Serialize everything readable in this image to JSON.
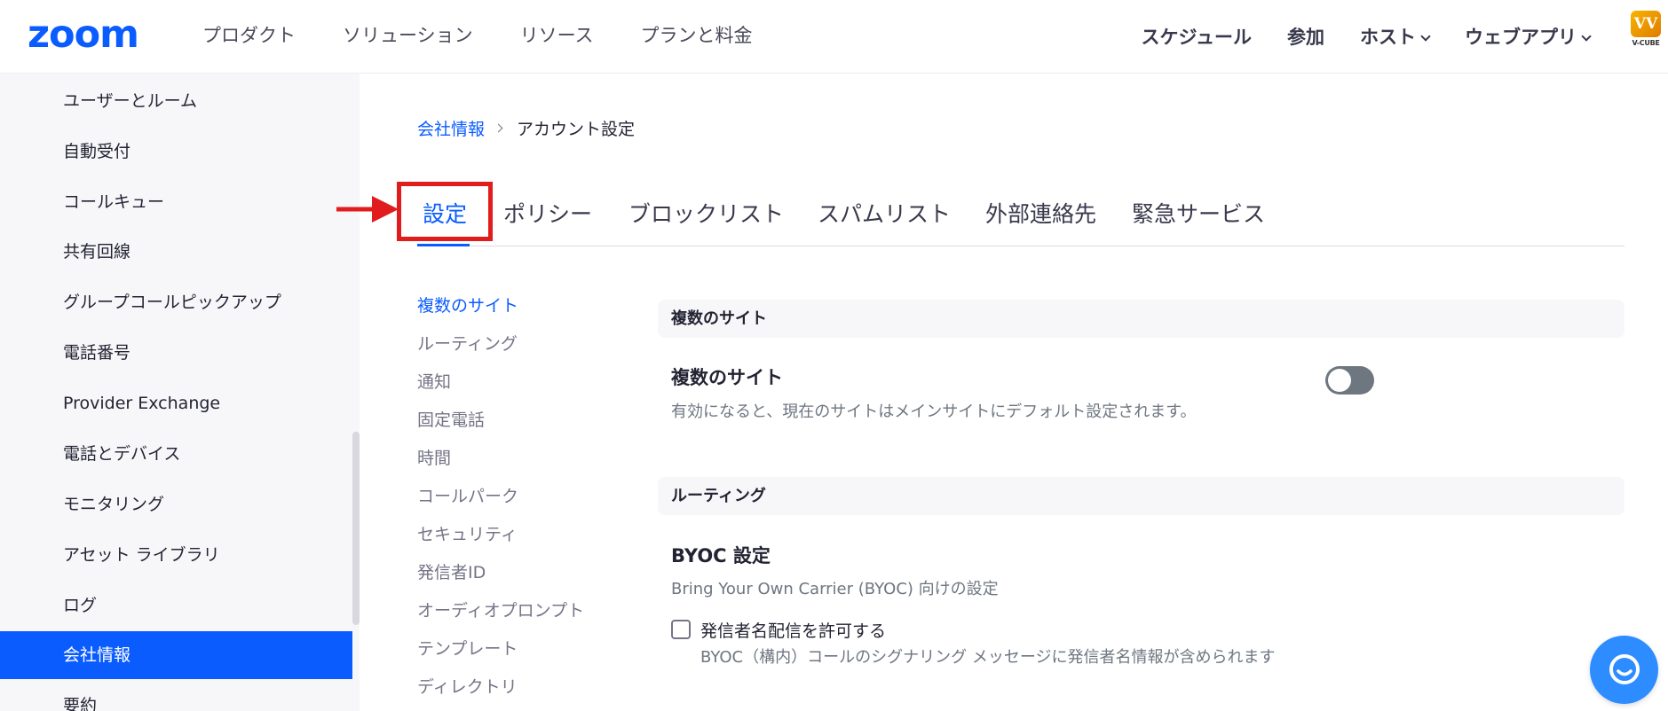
{
  "topnav": {
    "logo": "zoom",
    "left": [
      "プロダクト",
      "ソリューション",
      "リソース",
      "プランと料金"
    ],
    "right": [
      {
        "label": "スケジュール",
        "dropdown": false
      },
      {
        "label": "参加",
        "dropdown": false
      },
      {
        "label": "ホスト",
        "dropdown": true
      },
      {
        "label": "ウェブアプリ",
        "dropdown": true
      }
    ],
    "profile_logo_mark": "VV",
    "profile_logo_text": "V-CUBE"
  },
  "sidebar": {
    "items": [
      {
        "label": "ユーザーとルーム",
        "active": false
      },
      {
        "label": "自動受付",
        "active": false
      },
      {
        "label": "コールキュー",
        "active": false
      },
      {
        "label": "共有回線",
        "active": false
      },
      {
        "label": "グループコールピックアップ",
        "active": false
      },
      {
        "label": "電話番号",
        "active": false
      },
      {
        "label": "Provider Exchange",
        "active": false
      },
      {
        "label": "電話とデバイス",
        "active": false
      },
      {
        "label": "モニタリング",
        "active": false
      },
      {
        "label": "アセット ライブラリ",
        "active": false
      },
      {
        "label": "ログ",
        "active": false
      },
      {
        "label": "会社情報",
        "active": true
      },
      {
        "label": "要約",
        "active": false
      }
    ]
  },
  "breadcrumb": {
    "parent": "会社情報",
    "current": "アカウント設定"
  },
  "tabs": [
    {
      "label": "設定",
      "active": true
    },
    {
      "label": "ポリシー",
      "active": false
    },
    {
      "label": "ブロックリスト",
      "active": false
    },
    {
      "label": "スパムリスト",
      "active": false
    },
    {
      "label": "外部連絡先",
      "active": false
    },
    {
      "label": "緊急サービス",
      "active": false
    }
  ],
  "subnav": [
    {
      "label": "複数のサイト",
      "active": true
    },
    {
      "label": "ルーティング",
      "active": false
    },
    {
      "label": "通知",
      "active": false
    },
    {
      "label": "固定電話",
      "active": false
    },
    {
      "label": "時間",
      "active": false
    },
    {
      "label": "コールパーク",
      "active": false
    },
    {
      "label": "セキュリティ",
      "active": false
    },
    {
      "label": "発信者ID",
      "active": false
    },
    {
      "label": "オーディオプロンプト",
      "active": false
    },
    {
      "label": "テンプレート",
      "active": false
    },
    {
      "label": "ディレクトリ",
      "active": false
    }
  ],
  "content": {
    "multi_site": {
      "section": "複数のサイト",
      "title": "複数のサイト",
      "description": "有効になると、現在のサイトはメインサイトにデフォルト設定されます。",
      "enabled": false
    },
    "routing": {
      "section": "ルーティング",
      "title": "BYOC 設定",
      "description": "Bring Your Own Carrier (BYOC) 向けの設定",
      "checkbox_label": "発信者名配信を許可する",
      "checkbox_checked": false,
      "checkbox_description": "BYOC（構内）コールのシグナリング メッセージに発信者名情報が含められます"
    }
  },
  "colors": {
    "accent": "#0b5cff",
    "annotation": "#e11c1c",
    "sidebar_bg": "#f7f7fa",
    "chat": "#2d8cff"
  }
}
